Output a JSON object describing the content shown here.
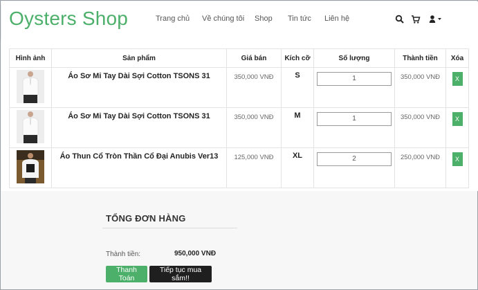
{
  "brand": "Oysters Shop",
  "nav": [
    {
      "label": "Trang chủ"
    },
    {
      "label": "Về chúng tôi"
    },
    {
      "label": "Shop"
    },
    {
      "label": "Tin tức"
    },
    {
      "label": "Liên hệ"
    }
  ],
  "header_icons": [
    "search-icon",
    "cart-icon",
    "user-icon",
    "caret-down-icon"
  ],
  "table": {
    "headers": [
      "Hình ảnh",
      "Sản phẩm",
      "Giá bán",
      "Kích cỡ",
      "Số lượng",
      "Thành tiền",
      "Xóa"
    ],
    "rows": [
      {
        "name": "Áo Sơ Mi Tay Dài Sợi Cotton TSONS 31",
        "price": "350,000 VNĐ",
        "size": "S",
        "qty": "1",
        "subtotal": "350,000 VNĐ",
        "delete": "X"
      },
      {
        "name": "Áo Sơ Mi Tay Dài Sợi Cotton TSONS 31",
        "price": "350,000 VNĐ",
        "size": "M",
        "qty": "1",
        "subtotal": "350,000 VNĐ",
        "delete": "X"
      },
      {
        "name": "Áo Thun Cổ Tròn Thần Cổ Đại Anubis Ver13",
        "price": "125,000 VNĐ",
        "size": "XL",
        "qty": "2",
        "subtotal": "250,000 VNĐ",
        "delete": "X"
      }
    ]
  },
  "summary": {
    "title": "TỔNG ĐƠN HÀNG",
    "total_label": "Thành tiền:",
    "total_value": "950,000 VNĐ",
    "pay_button": "Thanh Toán",
    "continue_button": "Tiếp tục mua sắm!!"
  },
  "colors": {
    "brand": "#4caf6a",
    "accent": "#4caf6a",
    "dark_button": "#1f1f1f"
  }
}
